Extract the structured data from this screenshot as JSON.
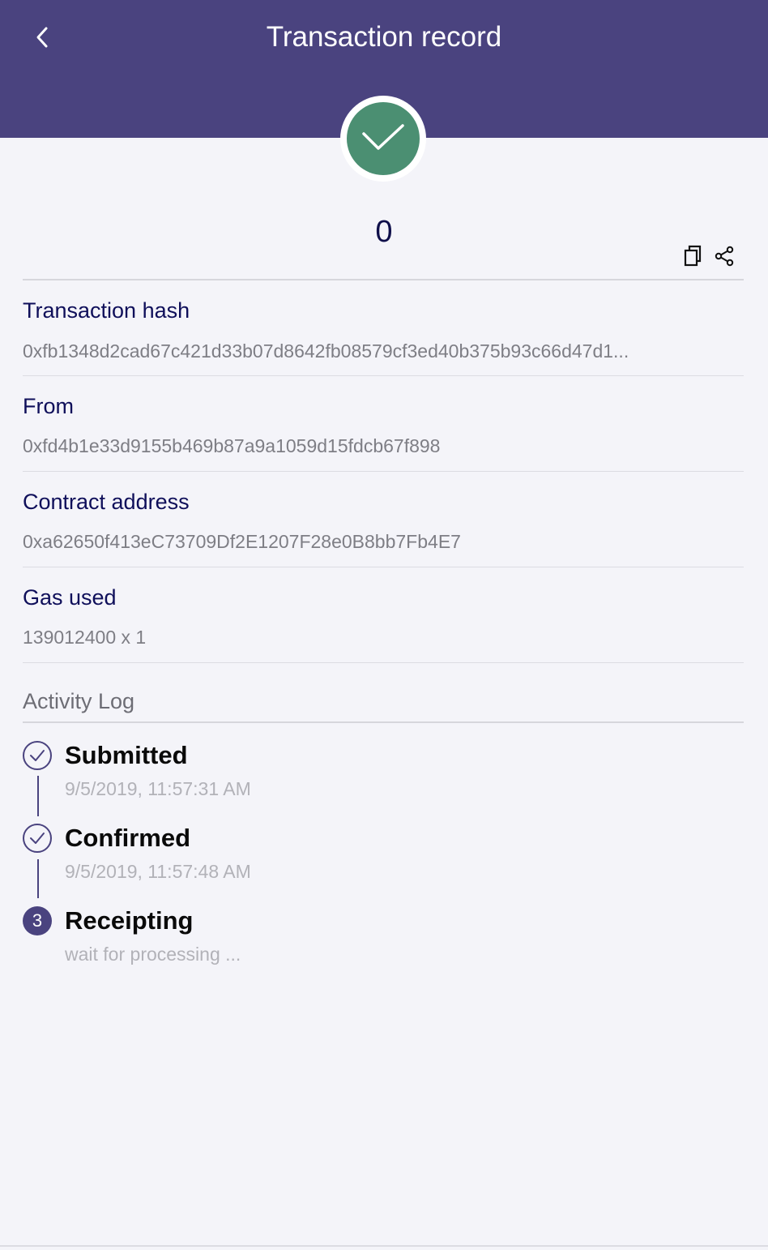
{
  "header": {
    "title": "Transaction record",
    "back_icon": "chevron-left-icon",
    "background_color": "#4a437f"
  },
  "status": {
    "icon": "check-icon",
    "color": "#4b8f72"
  },
  "amount": "0",
  "actions": {
    "copy_icon": "copy-icon",
    "share_icon": "share-icon"
  },
  "fields": [
    {
      "label": "Transaction hash",
      "value": "0xfb1348d2cad67c421d33b07d8642fb08579cf3ed40b375b93c66d47d1..."
    },
    {
      "label": "From",
      "value": "0xfd4b1e33d9155b469b87a9a1059d15fdcb67f898"
    },
    {
      "label": "Contract address",
      "value": "0xa62650f413eC73709Df2E1207F28e0B8bb7Fb4E7"
    },
    {
      "label": "Gas used",
      "value": "139012400 x 1"
    }
  ],
  "activity_log": {
    "title": "Activity Log",
    "steps": [
      {
        "title": "Submitted",
        "subtitle": "9/5/2019, 11:57:31 AM",
        "state": "done"
      },
      {
        "title": "Confirmed",
        "subtitle": "9/5/2019, 11:57:48 AM",
        "state": "done"
      },
      {
        "title": "Receipting",
        "subtitle": "wait for processing ...",
        "state": "current",
        "number": "3"
      }
    ]
  },
  "colors": {
    "accent": "#4a437f",
    "label_text": "#0f0f5a",
    "value_text": "#7e7e85",
    "background": "#f4f4f9"
  }
}
